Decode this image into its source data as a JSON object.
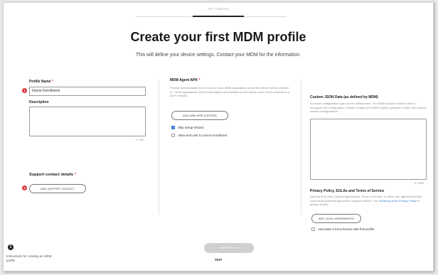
{
  "header": {
    "step_label": "GET STARTED"
  },
  "main": {
    "title": "Create your first MDM profile",
    "subtitle": "This will define your device settings. Contact your MDM for the information."
  },
  "left_col": {
    "profile_name_label": "Profile Name",
    "required_marker": "*",
    "profile_name_value": "Intune Enrollment",
    "description_label": "Description",
    "description_value": "",
    "description_counter": "0 / 200",
    "badge_1": "1",
    "support_label": "Support contact details",
    "add_support_label": "ADD SUPPORT CONTACT",
    "badge_2": "2"
  },
  "mid_col": {
    "apk_label": "MDM Agent APK",
    "apk_help": "Provide downloadable links of one or more MDM applications which the device will be enrolled to. These applications will be downloaded and installed on the device when it first connects to a Wi-Fi network.",
    "add_apps_label": "ADD MDM APPLICATIONS",
    "skip_wizard_label": "Skip Setup Wizard",
    "skip_wizard_checked": true,
    "allow_cancel_label": "Allow end user to cancel enrollment",
    "allow_cancel_checked": false
  },
  "right_col": {
    "json_label": "Custom JSON Data (as defined by MDM)",
    "json_help": "A custom configuration type can be defined here. The MDM solution must be able to recognize this configuration. Please contact your MDM solution provider to learn more about custom configurations.",
    "json_value": "",
    "json_counter": "0 / 2000",
    "privacy_label": "Privacy Policy, EULAs and Terms of Service",
    "privacy_help_1": "Add any End User License Agreements, Terms of Service, or other user agreements that users must acknowledge before using the device. The",
    "privacy_link": "Samsung Knox Privacy Policy",
    "privacy_help_2": "is always shown.",
    "add_legal_label": "ADD LEGAL AGREEMENTS",
    "knox_license_label": "Associate a Knox license with this profile",
    "knox_license_checked": false
  },
  "footer": {
    "save_label": "SAVE PROFILE",
    "skip_label": "SKIP",
    "info_icon_glyph": "i",
    "info_text": "Instructions for creating an MDM profile"
  }
}
